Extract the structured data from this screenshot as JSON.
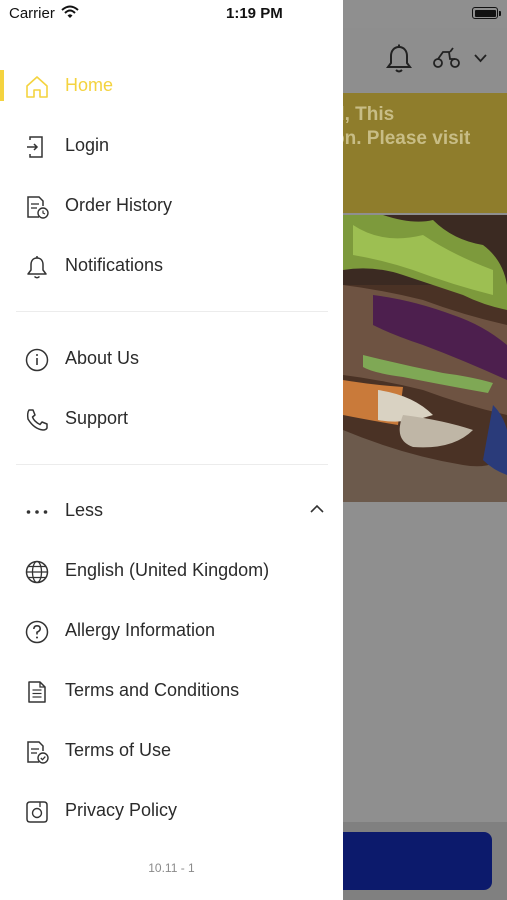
{
  "status_bar": {
    "carrier": "Carrier",
    "time": "1:19 PM"
  },
  "background": {
    "banner_text": "d, This\non. Please visit"
  },
  "drawer": {
    "accent_color": "#f4d33f",
    "items_top": [
      {
        "label": "Home",
        "icon": "home-icon",
        "active": true
      },
      {
        "label": "Login",
        "icon": "login-icon"
      },
      {
        "label": "Order History",
        "icon": "order-history-icon"
      },
      {
        "label": "Notifications",
        "icon": "bell-icon"
      }
    ],
    "items_mid": [
      {
        "label": "About Us",
        "icon": "info-icon"
      },
      {
        "label": "Support",
        "icon": "phone-icon"
      }
    ],
    "less": {
      "label": "Less",
      "icon": "more-dots-icon"
    },
    "items_more": [
      {
        "label": "English (United Kingdom)",
        "icon": "globe-icon"
      },
      {
        "label": "Allergy Information",
        "icon": "question-icon"
      },
      {
        "label": "Terms and Conditions",
        "icon": "document-icon"
      },
      {
        "label": "Terms of Use",
        "icon": "document-check-icon"
      },
      {
        "label": "Privacy Policy",
        "icon": "privacy-icon"
      }
    ],
    "version": "10.11 - 1"
  }
}
